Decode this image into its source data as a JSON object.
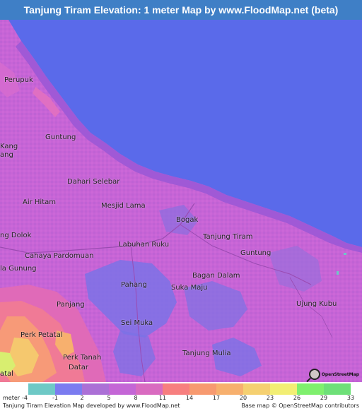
{
  "title": "Tanjung Tiram Elevation: 1 meter Map by www.FloodMap.net (beta)",
  "colors": {
    "title_bg": "#3f7fc6",
    "sea": "#5a6aea",
    "land_low": "#c764d6",
    "land_mid": "#a86ad0",
    "lowland_blue": "#7b72e6",
    "high_ground": "#f77f9a"
  },
  "places": [
    {
      "name": "Perupuk"
    },
    {
      "name": "Guntung"
    },
    {
      "name": "Kang"
    },
    {
      "name": "ang"
    },
    {
      "name": "Dahari Selebar"
    },
    {
      "name": "Air Hitam"
    },
    {
      "name": "Mesjid Lama"
    },
    {
      "name": "Bogak"
    },
    {
      "name": "Tanjung Tiram"
    },
    {
      "name": "ng Dolok"
    },
    {
      "name": "Labuhan Ruku"
    },
    {
      "name": "Cahaya Pardomuan"
    },
    {
      "name": "Guntung"
    },
    {
      "name": "la Gunung"
    },
    {
      "name": "Bagan Dalam"
    },
    {
      "name": "Pahang"
    },
    {
      "name": "Suka Maju"
    },
    {
      "name": "Panjang"
    },
    {
      "name": "Ujung Kubu"
    },
    {
      "name": "Sei Muka"
    },
    {
      "name": "Perk Petatal"
    },
    {
      "name": "Perk Tanah"
    },
    {
      "name": "Datar"
    },
    {
      "name": "Tanjung Mulia"
    },
    {
      "name": "atal"
    }
  ],
  "osm_logo_text": "OpenStreetMap",
  "legend": {
    "unit_label": "meter",
    "ticks": [
      "-4",
      "-1",
      "2",
      "5",
      "8",
      "11",
      "14",
      "17",
      "20",
      "23",
      "26",
      "29",
      "33"
    ],
    "colors": [
      "#6ec9c6",
      "#7b7cf0",
      "#ab70d6",
      "#c466d6",
      "#d96bc0",
      "#f77f7f",
      "#f79a70",
      "#f7b06e",
      "#f5d071",
      "#f2ee74",
      "#7ff06e",
      "#6ee078"
    ]
  },
  "footer": {
    "left": "Tanjung Tiram Elevation Map developed by www.FloodMap.net",
    "right": "Base map © OpenStreetMap contributors"
  }
}
